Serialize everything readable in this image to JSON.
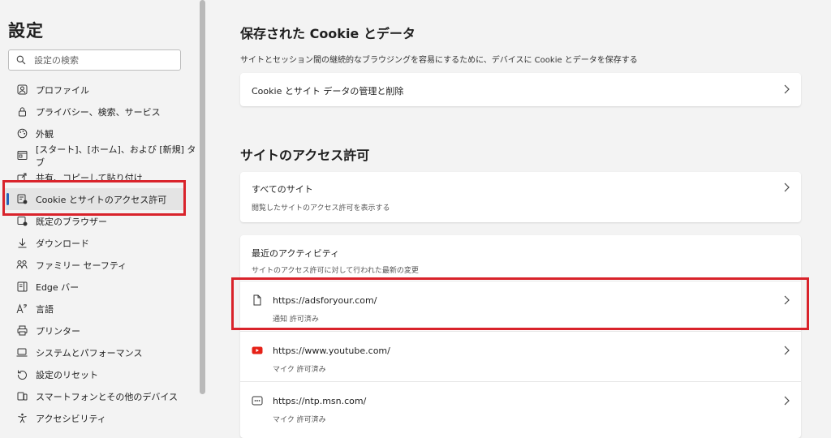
{
  "sidebar": {
    "title": "設定",
    "search_placeholder": "設定の検索",
    "items": [
      {
        "label": "プロファイル",
        "icon": "profile-icon"
      },
      {
        "label": "プライバシー、検索、サービス",
        "icon": "lock-icon"
      },
      {
        "label": "外観",
        "icon": "appearance-icon"
      },
      {
        "label": "[スタート]、[ホーム]、および [新規] タブ",
        "icon": "start-home-icon"
      },
      {
        "label": "共有、コピーして貼り付け",
        "icon": "share-icon"
      },
      {
        "label": "Cookie とサイトのアクセス許可",
        "icon": "cookie-permissions-icon",
        "active": true
      },
      {
        "label": "既定のブラウザー",
        "icon": "default-browser-icon"
      },
      {
        "label": "ダウンロード",
        "icon": "download-icon"
      },
      {
        "label": "ファミリー セーフティ",
        "icon": "family-icon"
      },
      {
        "label": "Edge バー",
        "icon": "edge-bar-icon"
      },
      {
        "label": "言語",
        "icon": "language-icon"
      },
      {
        "label": "プリンター",
        "icon": "printer-icon"
      },
      {
        "label": "システムとパフォーマンス",
        "icon": "system-icon"
      },
      {
        "label": "設定のリセット",
        "icon": "reset-icon"
      },
      {
        "label": "スマートフォンとその他のデバイス",
        "icon": "phone-icon"
      },
      {
        "label": "アクセシビリティ",
        "icon": "accessibility-icon"
      }
    ]
  },
  "cookies_section": {
    "title": "保存された Cookie とデータ",
    "description": "サイトとセッション間の継続的なブラウジングを容易にするために、デバイスに Cookie とデータを保存する",
    "manage_label": "Cookie とサイト データの管理と削除"
  },
  "permissions_section": {
    "title": "サイトのアクセス許可",
    "all_sites_label": "すべてのサイト",
    "all_sites_sub": "閲覧したサイトのアクセス許可を表示する",
    "recent_title": "最近のアクティビティ",
    "recent_sub": "サイトのアクセス許可に対して行われた最新の変更",
    "recent_sites": [
      {
        "url": "https://adsforyour.com/",
        "status": "通知 許可済み",
        "icon": "page-icon"
      },
      {
        "url": "https://www.youtube.com/",
        "status": "マイク 許可済み",
        "icon": "youtube-icon"
      },
      {
        "url": "https://ntp.msn.com/",
        "status": "マイク 許可済み",
        "icon": "msn-icon"
      }
    ]
  },
  "colors": {
    "highlight": "#d9232b",
    "accent": "#2862b8",
    "youtube": "#e62117"
  }
}
